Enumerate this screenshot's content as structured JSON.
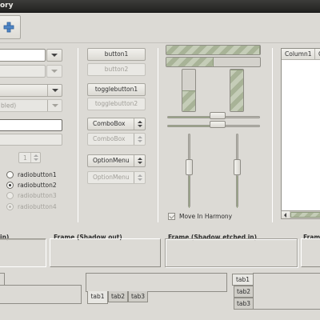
{
  "window": {
    "title_fragment": "ory"
  },
  "toolbar": {
    "add_icon": "plus-icon"
  },
  "left": {
    "combo_disabled_text": "bled)",
    "spin_value": "1",
    "radios": [
      {
        "label": "radiobutton1",
        "selected": false,
        "disabled": false
      },
      {
        "label": "radiobutton2",
        "selected": true,
        "disabled": false
      },
      {
        "label": "radiobutton3",
        "selected": false,
        "disabled": true
      },
      {
        "label": "radiobutton4",
        "selected": true,
        "disabled": true
      }
    ]
  },
  "buttons": {
    "button1": "button1",
    "button2": "button2",
    "toggle1": "togglebutton1",
    "toggle2": "togglebutton2",
    "combobox": "ComboBox",
    "combobox_dis": "ComboBox",
    "option": "OptionMenu",
    "option_dis": "OptionMenu"
  },
  "progress": {
    "h1_fraction": 1.0,
    "h2_fraction": 0.5,
    "v1_fraction": 0.5,
    "v2_fraction": 1.0,
    "scale_h1": 0.55,
    "scale_h2": 0.55,
    "scale_v1": 0.45,
    "scale_v2": 0.45,
    "move_in_harmony": "Move In Harmony"
  },
  "tree": {
    "columns": [
      "Column1",
      "C"
    ]
  },
  "frames": {
    "frame_in_label": "in)",
    "frame_out_label": "Frame (Shadow out)",
    "frame_etch_label": "Frame (Shadow etched in)",
    "frame_last_label": "Fram"
  },
  "notebooks": {
    "bottom_tabs": [
      "tab1",
      "tab2",
      "tab3"
    ],
    "side_tabs": [
      "tab1",
      "tab2",
      "tab3"
    ]
  }
}
